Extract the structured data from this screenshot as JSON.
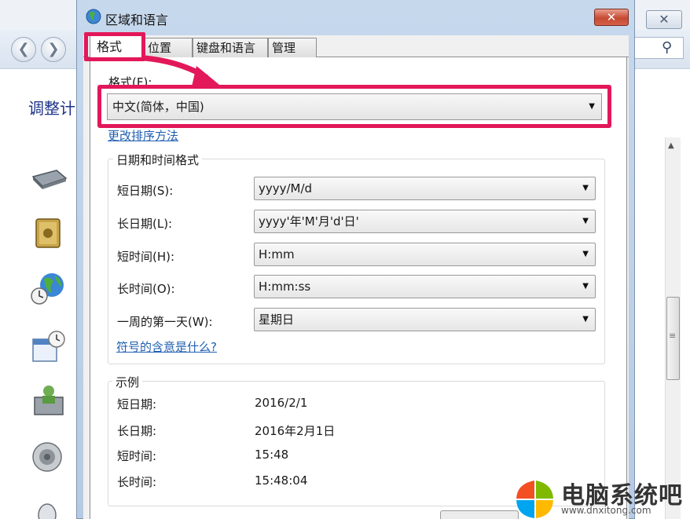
{
  "dialog": {
    "title": "区域和语言",
    "close_glyph": "✕",
    "tabs": [
      "格式",
      "位置",
      "键盘和语言",
      "管理"
    ]
  },
  "format": {
    "label": "格式(F):",
    "selected": "中文(简体，中国)",
    "sort_link": "更改排序方法"
  },
  "datetime": {
    "group_title": "日期和时间格式",
    "rows": [
      {
        "label": "短日期(S):",
        "value": "yyyy/M/d"
      },
      {
        "label": "长日期(L):",
        "value": "yyyy'年'M'月'd'日'"
      },
      {
        "label": "短时间(H):",
        "value": "H:mm"
      },
      {
        "label": "长时间(O):",
        "value": "H:mm:ss"
      },
      {
        "label": "一周的第一天(W):",
        "value": "星期日"
      }
    ],
    "symbols_link": "符号的含意是什么?"
  },
  "example": {
    "group_title": "示例",
    "rows": [
      {
        "label": "短日期:",
        "value": "2016/2/1"
      },
      {
        "label": "长日期:",
        "value": "2016年2月1日"
      },
      {
        "label": "短时间:",
        "value": "15:48"
      },
      {
        "label": "长时间:",
        "value": "15:48:04"
      }
    ]
  },
  "background": {
    "heading": "调整计",
    "close_glyph": "✕",
    "search_icon": "⚲",
    "nav_back": "❮",
    "nav_forward": "❯",
    "scroll_up": "▲",
    "scroll_grip": "≡"
  },
  "watermark": {
    "name": "电脑系统吧",
    "url": "www.dnxitong.com"
  },
  "colors": {
    "highlight": "#e2185a",
    "link": "#1f5fb0",
    "heading": "#1e3287"
  }
}
